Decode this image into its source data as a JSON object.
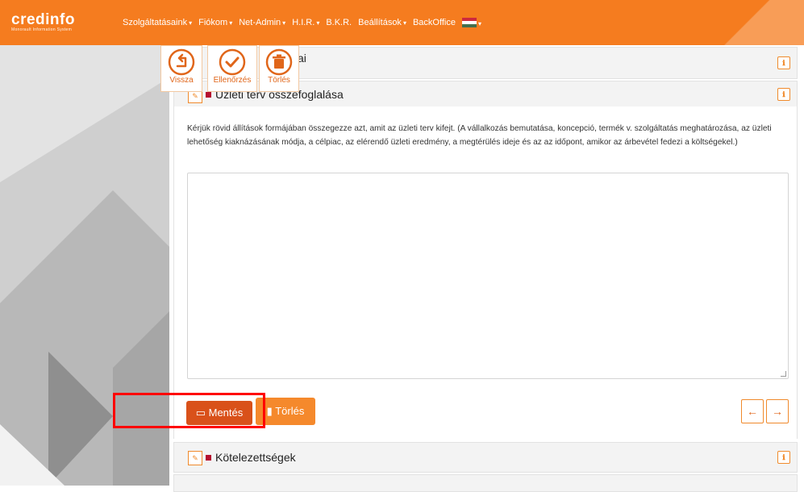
{
  "navbar": {
    "brand": "credinfo",
    "brand_sub": "Monorault Information System",
    "menu": [
      {
        "label": "Szolgáltatásaink",
        "caret": "▾"
      },
      {
        "label": "Fiókom",
        "caret": "▾"
      },
      {
        "label": "Net-Admin",
        "caret": "▾"
      },
      {
        "label": "H.I.R.",
        "caret": "▾"
      },
      {
        "label": "B.K.R.",
        "caret": ""
      },
      {
        "label": "Beállítások",
        "caret": "▾"
      },
      {
        "label": "BackOffice",
        "caret": ""
      }
    ],
    "flag_caret": "▾"
  },
  "toolbar": {
    "back_label": "Vissza",
    "check_label": "Ellenőrzés",
    "delete_label": "Törlés"
  },
  "sections": {
    "top_partial_title": "ai",
    "summary_title": "Üzleti terv összefoglalása",
    "summary_instructions": "Kérjük rövid állítások formájában összegezze azt, amit az üzleti terv kifejt. (A vállalkozás bemutatása, koncepció, termék v. szolgáltatás meghatározása, az üzleti lehetőség kiaknázásának módja, a célpiac, az elérendő üzleti eredmény, a megtérülés ideje és az az időpont, amikor az árbevétel fedezi a költségekel.)",
    "summary_text_value": "",
    "next_title": "Kötelezettségek"
  },
  "actions": {
    "save_label": "Mentés",
    "delete_label": "Törlés",
    "prev_icon": "←",
    "next_icon": "→"
  },
  "icons": {
    "pencil": "✎",
    "info": "ℹ"
  },
  "colors": {
    "brand_orange": "#f57c1f",
    "save_button": "#d9511a",
    "delete_button": "#f5892c",
    "section_marker": "#b5102f",
    "highlight_box": "#ff0000"
  }
}
